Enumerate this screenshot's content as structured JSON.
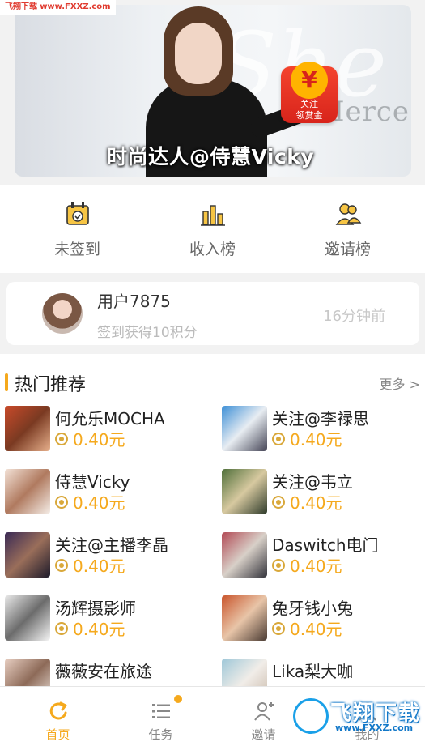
{
  "watermark": {
    "top_cn": "飞翔下载",
    "top_url": "www.FXXZ.com",
    "bottom_cn": "飞翔下载",
    "bottom_url": "www.FXXZ.com"
  },
  "banner": {
    "caption": "时尚达人@侍慧Vicky",
    "deco_script": "She",
    "deco_word": "Merce",
    "red_packet": {
      "symbol": "¥",
      "line1": "关注",
      "line2": "领赏金"
    }
  },
  "quick_actions": [
    {
      "label": "未签到",
      "icon": "calendar-check-icon"
    },
    {
      "label": "收入榜",
      "icon": "bar-chart-icon"
    },
    {
      "label": "邀请榜",
      "icon": "users-icon"
    }
  ],
  "sign_card": {
    "username": "用户7875",
    "info": "签到获得10积分",
    "time": "16分钟前"
  },
  "hot": {
    "title": "热门推荐",
    "more": "更多 >",
    "items": [
      {
        "name": "何允乐MOCHA",
        "price": "0.40元"
      },
      {
        "name": "关注@李禄思",
        "price": "0.40元"
      },
      {
        "name": "侍慧Vicky",
        "price": "0.40元"
      },
      {
        "name": "关注@韦立",
        "price": "0.40元"
      },
      {
        "name": "关注@主播李晶",
        "price": "0.40元"
      },
      {
        "name": "Daswitch电门",
        "price": "0.40元"
      },
      {
        "name": "汤辉摄影师",
        "price": "0.40元"
      },
      {
        "name": "兔牙钱小兔",
        "price": "0.40元"
      },
      {
        "name": "薇薇安在旅途",
        "price": ""
      },
      {
        "name": "Lika梨大咖",
        "price": ""
      }
    ]
  },
  "tabs": [
    {
      "label": "首页",
      "icon": "home-refresh-icon",
      "active": true
    },
    {
      "label": "任务",
      "icon": "task-list-icon",
      "active": false
    },
    {
      "label": "邀请",
      "icon": "invite-user-icon",
      "active": false
    },
    {
      "label": "我的",
      "icon": "profile-icon",
      "active": false
    }
  ],
  "colors": {
    "accent": "#f5a91d",
    "red_packet": "#e5302a",
    "watermark_blue": "#1177c8"
  }
}
